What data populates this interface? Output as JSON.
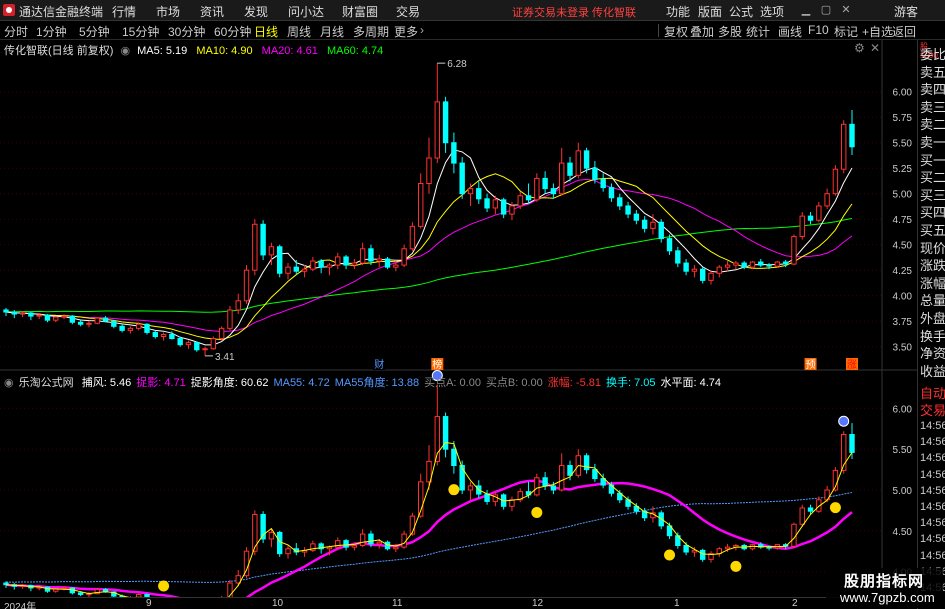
{
  "app": {
    "title": "通达信金融终端"
  },
  "menu": [
    "行情",
    "市场",
    "资讯",
    "发现",
    "问小达",
    "财富圈",
    "交易"
  ],
  "login_warning": "证券交易未登录  传化智联",
  "top_right": [
    "功能",
    "版面",
    "公式",
    "选项",
    "游客"
  ],
  "toolbar": {
    "periods": [
      "分时",
      "1分钟",
      "5分钟",
      "15分钟",
      "30分钟",
      "60分钟",
      "日线",
      "周线",
      "月线",
      "多周期",
      "更多"
    ],
    "active": "日线",
    "right": [
      "复权",
      "叠加",
      "多股",
      "统计",
      "画线",
      "F10",
      "标记",
      "+自选",
      "返回"
    ]
  },
  "main_chart": {
    "title": "传化智联(日线 前复权)",
    "ma": [
      {
        "label": "MA5: 5.19",
        "color": "#ffffff"
      },
      {
        "label": "MA10: 4.90",
        "color": "#ffff00"
      },
      {
        "label": "MA20: 4.61",
        "color": "#ff00ff"
      },
      {
        "label": "MA60: 4.74",
        "color": "#00ff00"
      }
    ],
    "y_ticks": [
      "6.00",
      "5.75",
      "5.50",
      "5.25",
      "5.00",
      "4.75",
      "4.50",
      "4.25",
      "4.00",
      "3.75",
      "3.50"
    ],
    "high_label": "6.28",
    "low_label": "3.41",
    "event_marks": [
      "财",
      "榜",
      "预",
      "涨"
    ]
  },
  "sub_chart": {
    "title": "乐淘公式网",
    "fields": [
      {
        "label": "捕风: 5.46",
        "color": "#ffffff"
      },
      {
        "label": "捉影: 4.71",
        "color": "#ff00ff"
      },
      {
        "label": "捉影角度: 60.62",
        "color": "#ffffff"
      },
      {
        "label": "MA55: 4.72",
        "color": "#5599ff"
      },
      {
        "label": "MA55角度: 13.88",
        "color": "#5599ff"
      },
      {
        "label": "买点A: 0.00",
        "color": "#888888"
      },
      {
        "label": "买点B: 0.00",
        "color": "#888888"
      },
      {
        "label": "涨幅: -5.81",
        "color": "#ff3030"
      },
      {
        "label": "换手: 7.05",
        "color": "#00ffff"
      },
      {
        "label": "水平面: 4.74",
        "color": "#ffffff"
      }
    ],
    "y_ticks": [
      "6.00",
      "5.50",
      "5.00",
      "4.50",
      "4.00"
    ]
  },
  "side_panel": {
    "items": [
      "委比",
      "卖五",
      "卖四",
      "卖三",
      "卖二",
      "卖一",
      "买一",
      "买二",
      "买三",
      "买四",
      "买五",
      "现价",
      "涨跌",
      "涨幅",
      "总量",
      "外盘",
      "换手",
      "净资",
      "收益",
      "自动",
      "交易"
    ],
    "times": [
      "14:56",
      "14:56",
      "14:56",
      "14:56",
      "14:56",
      "14:56",
      "14:56",
      "14:56",
      "14:56",
      "14:56",
      "14:56"
    ]
  },
  "date_axis": [
    "2024年",
    "9",
    "10",
    "11",
    "12",
    "1",
    "2"
  ],
  "watermark": {
    "line1": "股朋指标网",
    "line2": "www.7gpzb.com"
  },
  "colors": {
    "up": "#ff3030",
    "down": "#00ffff",
    "ma5": "#ffffff",
    "ma10": "#ffff00",
    "ma20": "#ff00ff",
    "ma60": "#00ff00",
    "sub_ma55": "#5599ff"
  },
  "chart_data": {
    "type": "candlestick",
    "title": "传化智联(日线 前复权)",
    "ylim": [
      3.35,
      6.35
    ],
    "x_ticks": [
      "2024年",
      "9",
      "10",
      "11",
      "12",
      "1",
      "2"
    ],
    "candles": [
      [
        3.86,
        3.88,
        3.8,
        3.84
      ],
      [
        3.84,
        3.86,
        3.78,
        3.82
      ],
      [
        3.82,
        3.85,
        3.79,
        3.83
      ],
      [
        3.83,
        3.84,
        3.76,
        3.8
      ],
      [
        3.8,
        3.83,
        3.77,
        3.81
      ],
      [
        3.81,
        3.82,
        3.74,
        3.76
      ],
      [
        3.76,
        3.8,
        3.74,
        3.79
      ],
      [
        3.79,
        3.82,
        3.77,
        3.8
      ],
      [
        3.8,
        3.81,
        3.72,
        3.74
      ],
      [
        3.74,
        3.76,
        3.7,
        3.72
      ],
      [
        3.72,
        3.75,
        3.69,
        3.73
      ],
      [
        3.73,
        3.79,
        3.72,
        3.78
      ],
      [
        3.78,
        3.8,
        3.74,
        3.75
      ],
      [
        3.75,
        3.76,
        3.68,
        3.7
      ],
      [
        3.7,
        3.72,
        3.64,
        3.66
      ],
      [
        3.66,
        3.7,
        3.63,
        3.68
      ],
      [
        3.68,
        3.74,
        3.66,
        3.72
      ],
      [
        3.72,
        3.73,
        3.62,
        3.64
      ],
      [
        3.64,
        3.66,
        3.58,
        3.6
      ],
      [
        3.6,
        3.64,
        3.56,
        3.62
      ],
      [
        3.62,
        3.65,
        3.57,
        3.58
      ],
      [
        3.58,
        3.6,
        3.5,
        3.52
      ],
      [
        3.52,
        3.56,
        3.48,
        3.54
      ],
      [
        3.54,
        3.55,
        3.45,
        3.47
      ],
      [
        3.47,
        3.5,
        3.41,
        3.48
      ],
      [
        3.48,
        3.6,
        3.47,
        3.58
      ],
      [
        3.58,
        3.7,
        3.56,
        3.68
      ],
      [
        3.68,
        3.9,
        3.66,
        3.86
      ],
      [
        3.86,
        4.02,
        3.82,
        3.95
      ],
      [
        3.95,
        4.3,
        3.92,
        4.25
      ],
      [
        4.25,
        4.75,
        4.2,
        4.7
      ],
      [
        4.7,
        4.74,
        4.35,
        4.4
      ],
      [
        4.4,
        4.52,
        4.3,
        4.48
      ],
      [
        4.48,
        4.5,
        4.18,
        4.22
      ],
      [
        4.22,
        4.32,
        4.16,
        4.28
      ],
      [
        4.28,
        4.35,
        4.2,
        4.24
      ],
      [
        4.24,
        4.3,
        4.18,
        4.26
      ],
      [
        4.26,
        4.38,
        4.24,
        4.34
      ],
      [
        4.34,
        4.36,
        4.22,
        4.28
      ],
      [
        4.28,
        4.32,
        4.2,
        4.3
      ],
      [
        4.3,
        4.42,
        4.26,
        4.38
      ],
      [
        4.38,
        4.4,
        4.26,
        4.3
      ],
      [
        4.3,
        4.36,
        4.26,
        4.32
      ],
      [
        4.32,
        4.52,
        4.3,
        4.46
      ],
      [
        4.46,
        4.5,
        4.3,
        4.34
      ],
      [
        4.34,
        4.4,
        4.28,
        4.36
      ],
      [
        4.36,
        4.38,
        4.26,
        4.28
      ],
      [
        4.28,
        4.34,
        4.24,
        4.3
      ],
      [
        4.3,
        4.5,
        4.28,
        4.46
      ],
      [
        4.46,
        4.72,
        4.44,
        4.68
      ],
      [
        4.68,
        5.2,
        4.66,
        5.1
      ],
      [
        5.1,
        5.55,
        5.0,
        5.35
      ],
      [
        5.35,
        6.28,
        5.3,
        5.9
      ],
      [
        5.9,
        5.95,
        5.4,
        5.5
      ],
      [
        5.5,
        5.6,
        5.2,
        5.3
      ],
      [
        5.3,
        5.36,
        4.95,
        5.0
      ],
      [
        5.0,
        5.1,
        4.88,
        5.05
      ],
      [
        5.05,
        5.12,
        4.9,
        4.95
      ],
      [
        4.95,
        5.0,
        4.82,
        4.86
      ],
      [
        4.86,
        4.98,
        4.8,
        4.94
      ],
      [
        4.94,
        4.96,
        4.76,
        4.8
      ],
      [
        4.8,
        4.92,
        4.74,
        4.88
      ],
      [
        4.88,
        5.02,
        4.85,
        4.98
      ],
      [
        4.98,
        5.1,
        4.9,
        4.94
      ],
      [
        4.94,
        5.2,
        4.92,
        5.15
      ],
      [
        5.15,
        5.22,
        5.0,
        5.05
      ],
      [
        5.05,
        5.1,
        4.95,
        5.0
      ],
      [
        5.0,
        5.45,
        4.98,
        5.3
      ],
      [
        5.3,
        5.36,
        5.12,
        5.18
      ],
      [
        5.18,
        5.5,
        5.15,
        5.42
      ],
      [
        5.42,
        5.45,
        5.2,
        5.25
      ],
      [
        5.25,
        5.32,
        5.1,
        5.14
      ],
      [
        5.14,
        5.2,
        5.02,
        5.06
      ],
      [
        5.06,
        5.1,
        4.92,
        4.96
      ],
      [
        4.96,
        5.0,
        4.84,
        4.88
      ],
      [
        4.88,
        4.92,
        4.76,
        4.8
      ],
      [
        4.8,
        4.84,
        4.7,
        4.74
      ],
      [
        4.74,
        4.78,
        4.62,
        4.66
      ],
      [
        4.66,
        4.8,
        4.6,
        4.72
      ],
      [
        4.72,
        4.75,
        4.52,
        4.56
      ],
      [
        4.56,
        4.6,
        4.4,
        4.44
      ],
      [
        4.44,
        4.48,
        4.28,
        4.32
      ],
      [
        4.32,
        4.36,
        4.2,
        4.24
      ],
      [
        4.24,
        4.3,
        4.18,
        4.26
      ],
      [
        4.26,
        4.28,
        4.12,
        4.15
      ],
      [
        4.15,
        4.25,
        4.11,
        4.22
      ],
      [
        4.22,
        4.3,
        4.18,
        4.28
      ],
      [
        4.28,
        4.34,
        4.24,
        4.3
      ],
      [
        4.3,
        4.34,
        4.26,
        4.32
      ],
      [
        4.32,
        4.34,
        4.26,
        4.28
      ],
      [
        4.28,
        4.34,
        4.26,
        4.33
      ],
      [
        4.33,
        4.36,
        4.28,
        4.3
      ],
      [
        4.3,
        4.32,
        4.26,
        4.29
      ],
      [
        4.29,
        4.34,
        4.27,
        4.33
      ],
      [
        4.33,
        4.35,
        4.28,
        4.31
      ],
      [
        4.31,
        4.6,
        4.3,
        4.58
      ],
      [
        4.58,
        4.82,
        4.55,
        4.78
      ],
      [
        4.78,
        4.82,
        4.7,
        4.74
      ],
      [
        4.74,
        4.92,
        4.72,
        4.88
      ],
      [
        4.88,
        5.05,
        4.85,
        5.0
      ],
      [
        5.0,
        5.28,
        4.98,
        5.24
      ],
      [
        5.24,
        5.72,
        5.2,
        5.68
      ],
      [
        5.68,
        5.82,
        5.38,
        5.46
      ]
    ]
  }
}
